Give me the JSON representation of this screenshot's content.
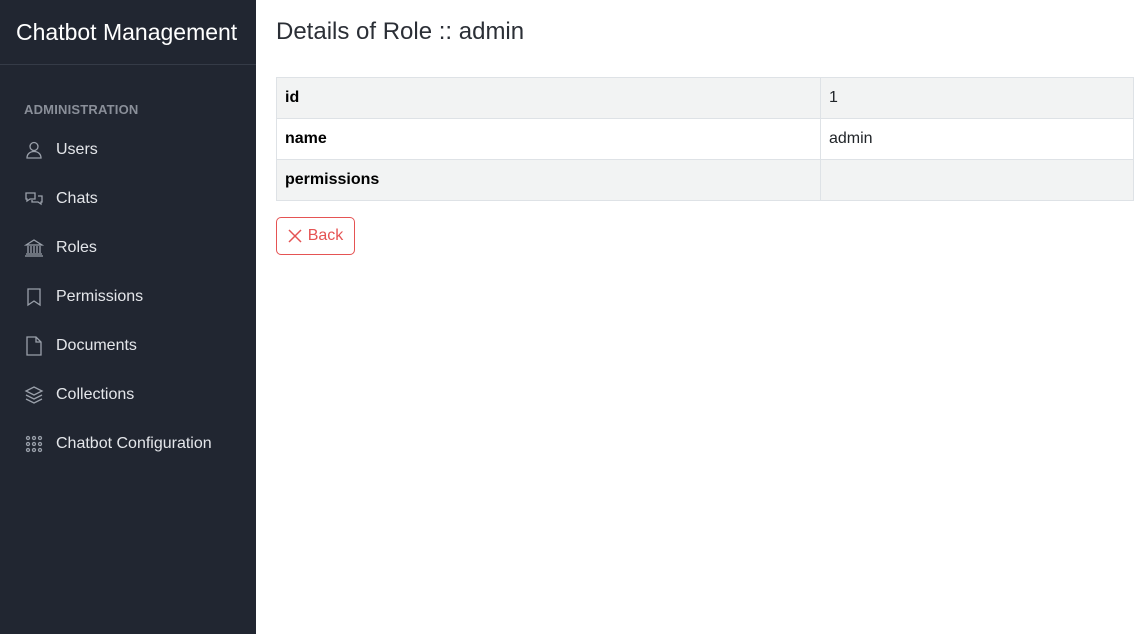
{
  "sidebar": {
    "brand": "Chatbot Management",
    "section": "ADMINISTRATION",
    "items": [
      {
        "label": "Users",
        "icon": "user-icon"
      },
      {
        "label": "Chats",
        "icon": "chat-icon"
      },
      {
        "label": "Roles",
        "icon": "bank-icon"
      },
      {
        "label": "Permissions",
        "icon": "bookmark-icon"
      },
      {
        "label": "Documents",
        "icon": "document-icon"
      },
      {
        "label": "Collections",
        "icon": "layers-icon"
      },
      {
        "label": "Chatbot Configuration",
        "icon": "grid-dots-icon"
      }
    ]
  },
  "main": {
    "title": "Details of Role :: admin",
    "rows": [
      {
        "key": "id",
        "value": "1"
      },
      {
        "key": "name",
        "value": "admin"
      },
      {
        "key": "permissions",
        "value": ""
      }
    ],
    "back_label": "Back"
  },
  "colors": {
    "sidebar_bg": "#212631",
    "danger": "#e55353",
    "stripe": "#f2f3f3"
  }
}
